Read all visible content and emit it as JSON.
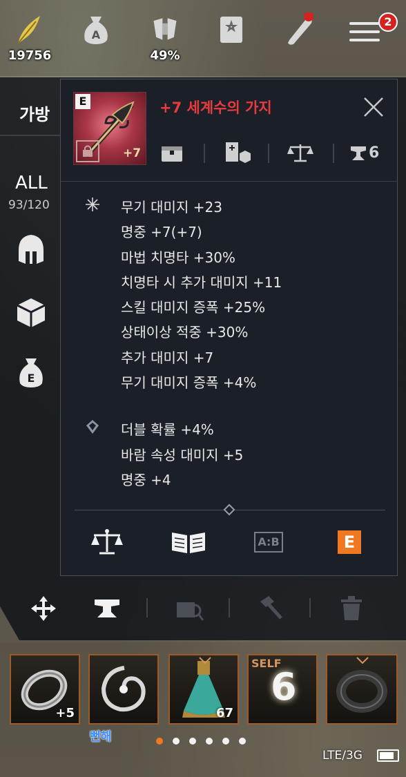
{
  "hud": {
    "feather": {
      "icon": "feather-icon",
      "value": "19756"
    },
    "money_bag": {
      "icon": "money-bag-icon"
    },
    "weight": {
      "icon": "weight-icon",
      "value": "49%"
    },
    "star_book": {
      "icon": "star-book-icon"
    },
    "scroll": {
      "icon": "scroll-icon"
    },
    "menu": {
      "icon": "hamburger-menu-icon",
      "badge": "2"
    }
  },
  "sidebar": {
    "title": "가방",
    "filter_all": "ALL",
    "count": "93/120",
    "categories": [
      "helmet-icon",
      "box-icon",
      "e-bag-icon"
    ]
  },
  "tooltip": {
    "grade": "E",
    "item_name": "+7 세계수의 가지",
    "enhance": "+7",
    "info_icons": [
      "chest-icon",
      "storage-icon",
      "scale-icon",
      "anvil-icon"
    ],
    "anvil_count": "6",
    "main_stats": [
      "무기 대미지 +23",
      "명중 +7(+7)",
      "마법 치명타 +30%",
      "치명타 시 추가 대미지 +11",
      "스킬 대미지 증폭 +25%",
      "상태이상 적중 +30%",
      "추가 대미지 +7",
      "무기 대미지 증폭 +4%"
    ],
    "sub_stats": [
      "더블 확률 +4%",
      "바람 속성 대미지 +5",
      "명중 +4"
    ],
    "footer": {
      "compare_icon": "scale-icon",
      "book_icon": "book-icon",
      "ab_label": "A:B",
      "e_label": "E"
    }
  },
  "toolbar": [
    "move-icon",
    "anvil-icon",
    "search-box-icon",
    "hammer-icon",
    "trash-icon"
  ],
  "quick_slots": [
    {
      "icon": "ring-icon",
      "label": "+5"
    },
    {
      "icon": "vortex-icon",
      "label": ""
    },
    {
      "icon": "potion-icon",
      "label": "67"
    },
    {
      "icon": "self-buff-icon",
      "tag": "SELF",
      "big": "6"
    },
    {
      "icon": "dark-ring-icon",
      "label": ""
    }
  ],
  "player_tag": "뻔해",
  "page_dots": {
    "count": 6,
    "active": 0
  },
  "status": {
    "network": "LTE/3G",
    "battery_level": 0.85
  }
}
